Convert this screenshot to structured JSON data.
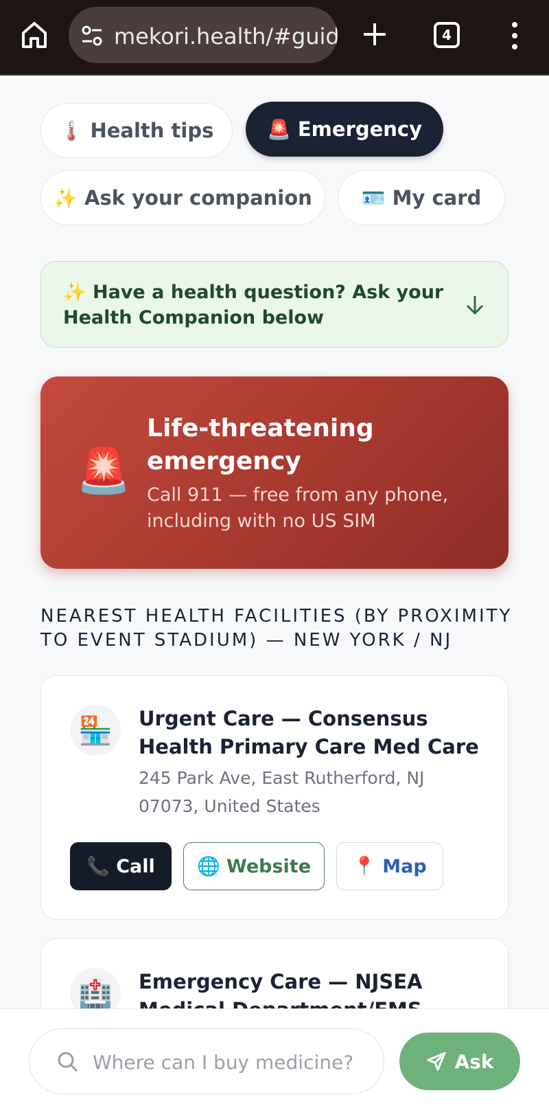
{
  "browser": {
    "url": "mekori.health/#guid",
    "tab_count": "4"
  },
  "nav_pills": [
    {
      "emoji": "🌡️",
      "label": "Health tips"
    },
    {
      "emoji": "🚨",
      "label": "Emergency"
    },
    {
      "emoji": "✨",
      "label": "Ask your companion"
    },
    {
      "emoji": "🪪",
      "label": "My card"
    }
  ],
  "notice": {
    "text": "✨ Have a health question? Ask your Health Companion below"
  },
  "emergency_card": {
    "emoji": "🚨",
    "title": "Life-threatening emergency",
    "subtitle": "Call 911 — free from any phone, including with no US SIM"
  },
  "facilities_heading": "NEAREST HEALTH FACILITIES (BY PROXIMITY TO EVENT STADIUM) — NEW YORK / NJ",
  "facilities": [
    {
      "emoji": "🏪",
      "name": "Urgent Care — Consensus Health Primary Care Med Care",
      "address": "245 Park Ave, East Rutherford, NJ 07073, United States",
      "call_label": "📞 Call",
      "website_label": "🌐 Website",
      "map_label": "📍 Map"
    },
    {
      "emoji": "🏥",
      "name": "Emergency Care — NJSEA Medical Department/EMS"
    }
  ],
  "ask_bar": {
    "placeholder": "Where can I buy medicine?",
    "button_label": "Ask"
  },
  "colors": {
    "active_pill": "#1b2233",
    "emergency_red": "#b4413a",
    "ask_green": "#6fb17b",
    "notice_bg": "#ebf6ea"
  }
}
